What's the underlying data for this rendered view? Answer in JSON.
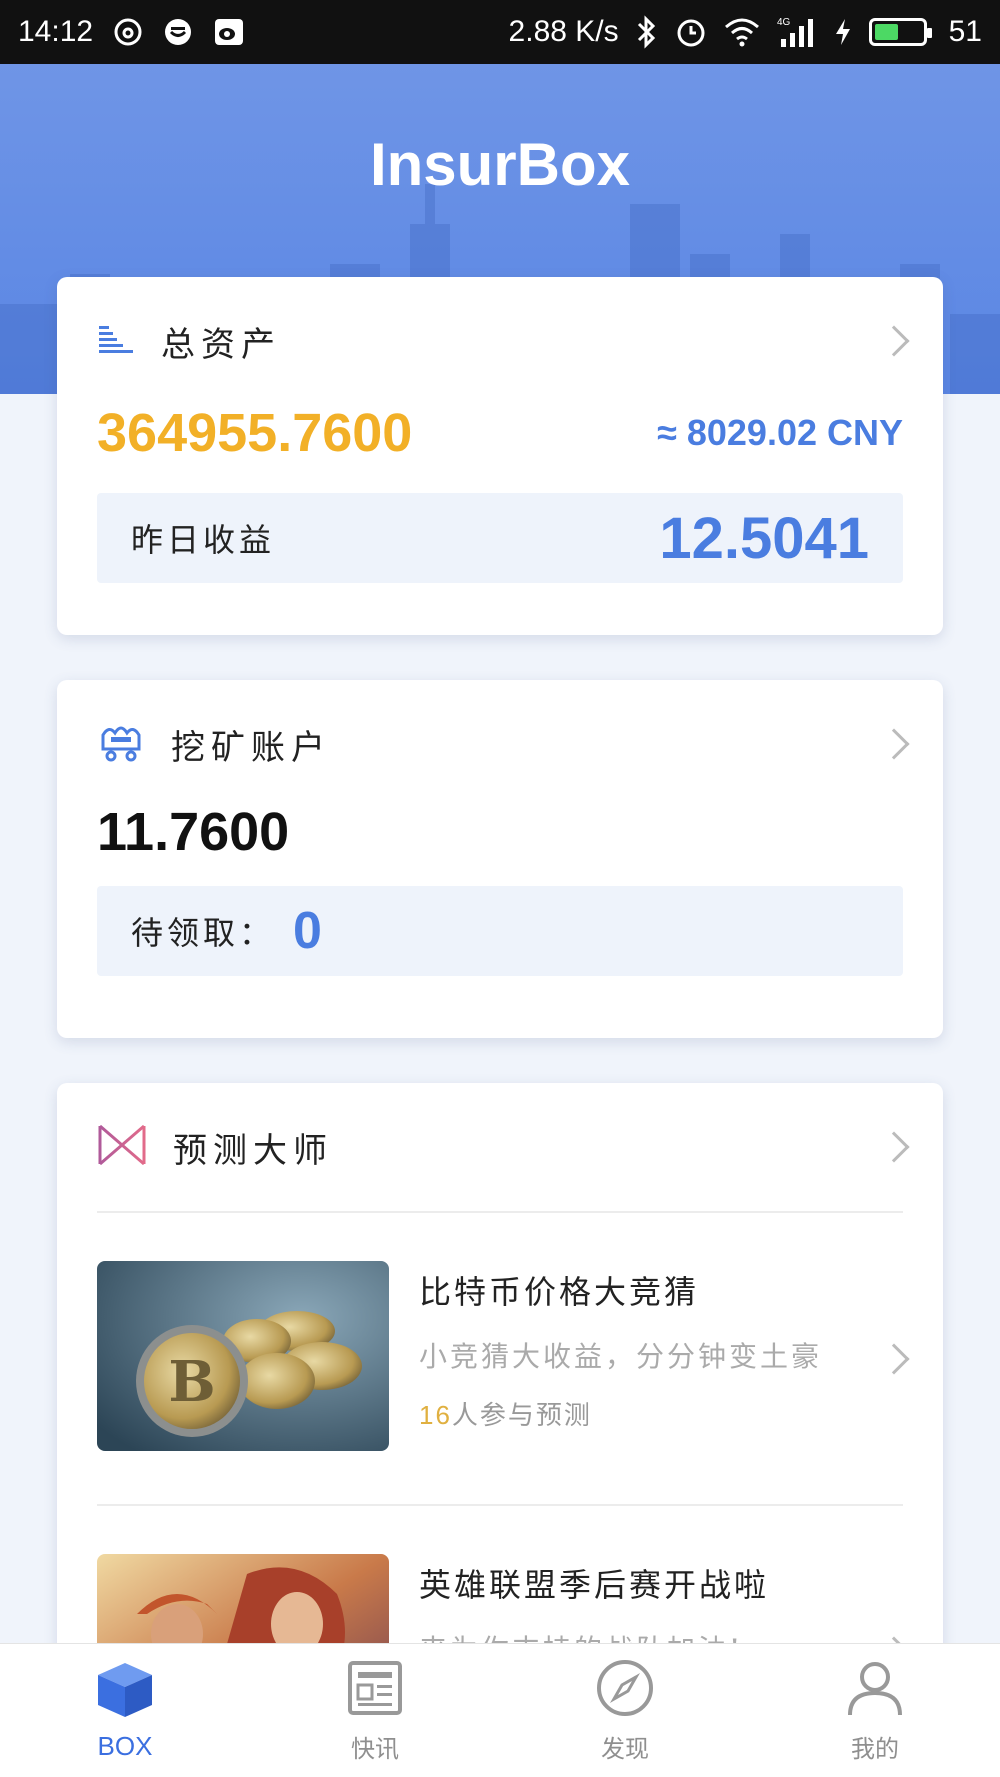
{
  "status_bar": {
    "time": "14:12",
    "speed": "2.88 K/s",
    "network": "4G",
    "battery": "51",
    "battery_level": 0.51
  },
  "header": {
    "title": "InsurBox"
  },
  "assets_card": {
    "title": "总资产",
    "amount": "364955.7600",
    "cny": "≈ 8029.02 CNY",
    "yesterday_label": "昨日收益",
    "yesterday_value": "12.5041"
  },
  "mining_card": {
    "title": "挖矿账户",
    "amount": "11.7600",
    "pending_label": "待领取：",
    "pending_value": "0"
  },
  "predict_card": {
    "title": "预测大师",
    "items": [
      {
        "title": "比特币价格大竞猜",
        "desc": "小竞猜大收益，分分钟变土豪",
        "count": "16",
        "count_suffix": "人参与预测"
      },
      {
        "title": "英雄联盟季后赛开战啦",
        "desc": "来为你支持的战队加油!"
      }
    ]
  },
  "bottom_nav": [
    {
      "label": "BOX",
      "icon": "box-icon",
      "active": true
    },
    {
      "label": "快讯",
      "icon": "news-icon",
      "active": false
    },
    {
      "label": "发现",
      "icon": "compass-icon",
      "active": false
    },
    {
      "label": "我的",
      "icon": "user-icon",
      "active": false
    }
  ],
  "colors": {
    "accent": "#4a7de0",
    "gold": "#f2b027",
    "header": "#5a86e4"
  }
}
